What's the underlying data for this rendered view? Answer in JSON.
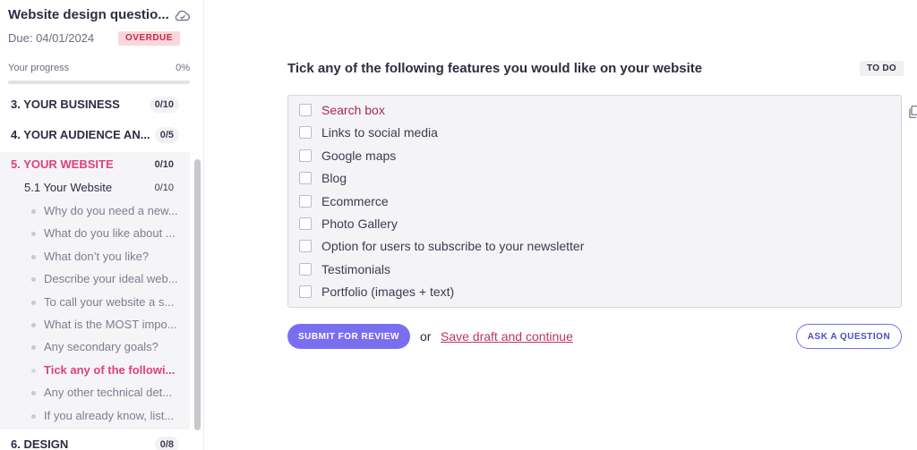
{
  "project": {
    "title": "Website design questio...",
    "due_label": "Due:  04/01/2024",
    "overdue": "OVERDUE",
    "progress_label": "Your progress",
    "progress_pct": "0%",
    "progress_value": 0
  },
  "sections": [
    {
      "label": "3. YOUR BUSINESS",
      "count": "0/10"
    },
    {
      "label": "4. YOUR AUDIENCE AN...",
      "count": "0/5"
    },
    {
      "label": "5. YOUR WEBSITE",
      "count": "0/10"
    },
    {
      "label": "6. DESIGN",
      "count": "0/8"
    }
  ],
  "subsection": {
    "label": "5.1 Your Website",
    "count": "0/10"
  },
  "questions": [
    "Why do you need a new...",
    "What do you like about ...",
    "What don’t you like?",
    "Describe your ideal web...",
    "To call your website a s...",
    "What is the MOST impo...",
    "Any secondary goals?",
    "Tick any of the followi...",
    "Any other technical det...",
    "If you already know, list..."
  ],
  "main": {
    "question": "Tick any of the following features you would like on your website",
    "status": "TO DO",
    "options": [
      "Search box",
      "Links to social media",
      "Google maps",
      "Blog",
      "Ecommerce",
      "Photo Gallery",
      "Option for users to subscribe to your newsletter",
      "Testimonials",
      "Portfolio (images + text)"
    ],
    "submit_label": "SUBMIT FOR REVIEW",
    "or_label": "or",
    "draft_label": "Save draft and continue",
    "ask_label": "ASK A QUESTION"
  },
  "colors": {
    "accent": "#7a6ef0",
    "active_pink": "#e0417a",
    "overdue_bg": "#fbd7dc"
  }
}
